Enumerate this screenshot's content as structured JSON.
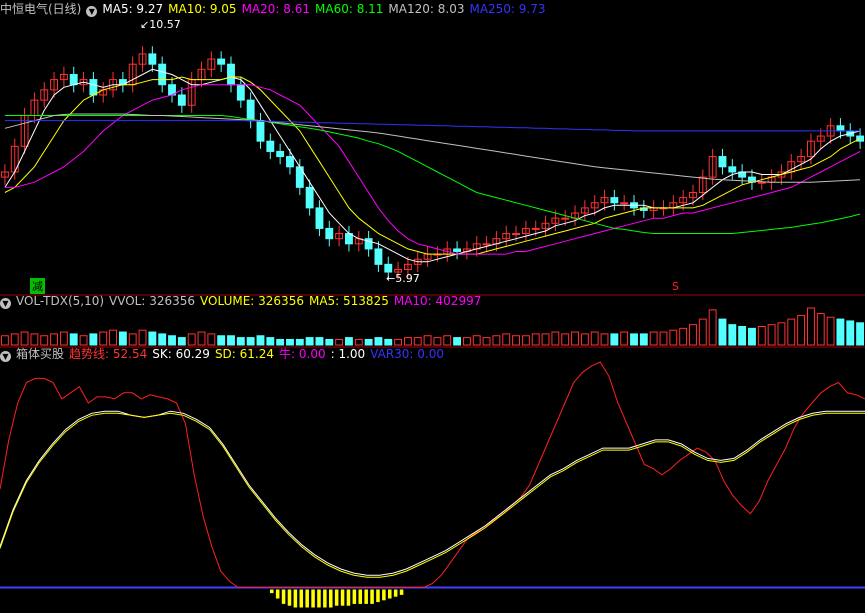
{
  "main_panel": {
    "stock_name": "中恒电气(日线)",
    "indicators": [
      {
        "label": "MA5: 9.27",
        "color": "#ffffff"
      },
      {
        "label": "MA10: 9.05",
        "color": "#ffff00"
      },
      {
        "label": "MA20: 8.61",
        "color": "#ff00ff"
      },
      {
        "label": "MA60: 8.11",
        "color": "#00ff00"
      },
      {
        "label": "MA120: 8.03",
        "color": "#c0c0c0"
      },
      {
        "label": "MA250: 9.73",
        "color": "#3333ff"
      }
    ],
    "high_label": "10.57",
    "low_label": "5.97",
    "reduce_tag": "减",
    "s_tag": "S"
  },
  "vol_panel": {
    "indicators": [
      {
        "label": "VOL-TDX(5,10)",
        "color": "#c0c0c0"
      },
      {
        "label": "VVOL: 326356",
        "color": "#c0c0c0"
      },
      {
        "label": "VOLUME: 326356",
        "color": "#ffff00"
      },
      {
        "label": "MA5: 513825",
        "color": "#ffff00"
      },
      {
        "label": "MA10: 402997",
        "color": "#ff00ff"
      }
    ]
  },
  "box_panel": {
    "indicators": [
      {
        "label": "箱体买股",
        "color": "#c0c0c0"
      },
      {
        "label": "趋势线: 52.54",
        "color": "#ff3333"
      },
      {
        "label": "SK: 60.29",
        "color": "#ffffff"
      },
      {
        "label": "SD: 61.24",
        "color": "#ffff00"
      },
      {
        "label": "牛: 0.00",
        "color": "#ff00ff"
      },
      {
        "label": ": 1.00",
        "color": "#ffffff"
      },
      {
        "label": "VAR30: 0.00",
        "color": "#3333ff"
      }
    ]
  },
  "chart_data": [
    {
      "type": "candlestick",
      "panel": "price",
      "ylim": [
        5.6,
        10.9
      ],
      "close": [
        7.9,
        8.4,
        9.0,
        9.3,
        9.5,
        9.7,
        9.8,
        9.6,
        9.7,
        9.4,
        9.5,
        9.7,
        9.6,
        10.0,
        10.2,
        10.0,
        9.6,
        9.4,
        9.2,
        9.7,
        9.9,
        10.1,
        10.0,
        9.6,
        9.3,
        8.9,
        8.5,
        8.3,
        8.2,
        8.0,
        7.6,
        7.2,
        6.8,
        6.6,
        6.7,
        6.5,
        6.6,
        6.4,
        6.1,
        5.95,
        6.0,
        6.1,
        6.2,
        6.3,
        6.3,
        6.4,
        6.35,
        6.4,
        6.5,
        6.5,
        6.6,
        6.7,
        6.7,
        6.8,
        6.8,
        6.9,
        7.0,
        7.0,
        7.1,
        7.2,
        7.3,
        7.4,
        7.3,
        7.3,
        7.2,
        7.15,
        7.2,
        7.2,
        7.3,
        7.4,
        7.5,
        7.8,
        8.2,
        8.0,
        7.9,
        7.8,
        7.7,
        7.7,
        7.8,
        7.9,
        8.1,
        8.2,
        8.5,
        8.6,
        8.8,
        8.7,
        8.6,
        8.5
      ],
      "ma": {
        "MA5": [
          7.6,
          7.9,
          8.3,
          8.7,
          9.1,
          9.4,
          9.55,
          9.6,
          9.65,
          9.6,
          9.55,
          9.6,
          9.6,
          9.7,
          9.8,
          9.9,
          9.85,
          9.8,
          9.7,
          9.6,
          9.6,
          9.65,
          9.7,
          9.75,
          9.7,
          9.5,
          9.2,
          8.9,
          8.6,
          8.3,
          8.0,
          7.7,
          7.4,
          7.1,
          6.9,
          6.7,
          6.6,
          6.55,
          6.5,
          6.4,
          6.3,
          6.2,
          6.15,
          6.15,
          6.2,
          6.25,
          6.3,
          6.35,
          6.4,
          6.45,
          6.5,
          6.55,
          6.6,
          6.65,
          6.7,
          6.75,
          6.85,
          6.9,
          6.95,
          7.05,
          7.1,
          7.2,
          7.25,
          7.25,
          7.25,
          7.25,
          7.2,
          7.2,
          7.2,
          7.25,
          7.3,
          7.45,
          7.6,
          7.75,
          7.85,
          7.9,
          7.9,
          7.85,
          7.85,
          7.85,
          7.95,
          8.05,
          8.15,
          8.35,
          8.5,
          8.6,
          8.65,
          8.7
        ],
        "MA10": [
          7.5,
          7.6,
          7.8,
          8.0,
          8.3,
          8.6,
          8.9,
          9.1,
          9.3,
          9.4,
          9.5,
          9.55,
          9.6,
          9.6,
          9.65,
          9.7,
          9.7,
          9.7,
          9.75,
          9.7,
          9.7,
          9.7,
          9.7,
          9.75,
          9.75,
          9.65,
          9.5,
          9.3,
          9.1,
          8.9,
          8.7,
          8.4,
          8.1,
          7.8,
          7.5,
          7.2,
          7.0,
          6.85,
          6.7,
          6.6,
          6.5,
          6.4,
          6.35,
          6.3,
          6.3,
          6.3,
          6.3,
          6.3,
          6.3,
          6.35,
          6.4,
          6.45,
          6.5,
          6.55,
          6.6,
          6.65,
          6.7,
          6.75,
          6.8,
          6.85,
          6.9,
          7.0,
          7.05,
          7.1,
          7.15,
          7.2,
          7.2,
          7.2,
          7.2,
          7.2,
          7.2,
          7.25,
          7.35,
          7.45,
          7.55,
          7.65,
          7.7,
          7.75,
          7.8,
          7.85,
          7.9,
          7.95,
          8.0,
          8.1,
          8.2,
          8.35,
          8.45,
          8.55
        ],
        "MA20": [
          7.6,
          7.6,
          7.65,
          7.7,
          7.8,
          7.9,
          8.0,
          8.15,
          8.3,
          8.5,
          8.7,
          8.85,
          9.0,
          9.1,
          9.2,
          9.3,
          9.35,
          9.4,
          9.5,
          9.55,
          9.6,
          9.6,
          9.6,
          9.6,
          9.6,
          9.6,
          9.55,
          9.5,
          9.4,
          9.3,
          9.2,
          9.0,
          8.8,
          8.6,
          8.4,
          8.1,
          7.8,
          7.5,
          7.2,
          6.95,
          6.75,
          6.6,
          6.5,
          6.45,
          6.4,
          6.35,
          6.3,
          6.3,
          6.3,
          6.3,
          6.3,
          6.3,
          6.35,
          6.35,
          6.4,
          6.45,
          6.5,
          6.55,
          6.6,
          6.65,
          6.7,
          6.75,
          6.8,
          6.85,
          6.9,
          6.95,
          7.0,
          7.0,
          7.05,
          7.1,
          7.1,
          7.15,
          7.2,
          7.25,
          7.3,
          7.35,
          7.4,
          7.45,
          7.5,
          7.55,
          7.6,
          7.7,
          7.8,
          7.9,
          8.0,
          8.1,
          8.2,
          8.3
        ],
        "MA60": [
          9.0,
          9.0,
          9.0,
          9.0,
          9.0,
          9.0,
          9.0,
          9.0,
          9.0,
          9.0,
          9.0,
          9.0,
          9.0,
          9.0,
          9.0,
          9.0,
          9.0,
          9.0,
          9.0,
          9.0,
          9.0,
          9.0,
          9.0,
          8.98,
          8.95,
          8.92,
          8.9,
          8.87,
          8.84,
          8.81,
          8.78,
          8.75,
          8.72,
          8.68,
          8.64,
          8.6,
          8.56,
          8.5,
          8.45,
          8.38,
          8.3,
          8.2,
          8.1,
          8.0,
          7.9,
          7.8,
          7.7,
          7.6,
          7.5,
          7.45,
          7.4,
          7.35,
          7.3,
          7.25,
          7.2,
          7.15,
          7.1,
          7.05,
          7.0,
          6.95,
          6.9,
          6.85,
          6.8,
          6.78,
          6.75,
          6.72,
          6.7,
          6.7,
          6.7,
          6.7,
          6.7,
          6.7,
          6.7,
          6.7,
          6.7,
          6.72,
          6.74,
          6.76,
          6.78,
          6.8,
          6.82,
          6.85,
          6.88,
          6.91,
          6.95,
          6.99,
          7.03,
          7.08
        ],
        "MA120": [
          8.75,
          8.8,
          8.85,
          8.9,
          8.95,
          9.0,
          9.02,
          9.03,
          9.03,
          9.03,
          9.03,
          9.03,
          9.03,
          9.02,
          9.01,
          9.0,
          9.0,
          8.99,
          8.98,
          8.97,
          8.96,
          8.95,
          8.94,
          8.93,
          8.92,
          8.91,
          8.9,
          8.88,
          8.86,
          8.84,
          8.82,
          8.8,
          8.78,
          8.76,
          8.74,
          8.72,
          8.7,
          8.68,
          8.66,
          8.63,
          8.6,
          8.57,
          8.54,
          8.51,
          8.48,
          8.45,
          8.42,
          8.39,
          8.36,
          8.33,
          8.3,
          8.27,
          8.24,
          8.21,
          8.18,
          8.15,
          8.12,
          8.09,
          8.06,
          8.03,
          8.0,
          7.98,
          7.96,
          7.94,
          7.92,
          7.9,
          7.88,
          7.86,
          7.84,
          7.82,
          7.8,
          7.78,
          7.76,
          7.75,
          7.74,
          7.73,
          7.72,
          7.71,
          7.7,
          7.7,
          7.7,
          7.7,
          7.7,
          7.71,
          7.72,
          7.73,
          7.74,
          7.75
        ],
        "MA250": [
          8.9,
          8.9,
          8.9,
          8.9,
          8.9,
          8.9,
          8.9,
          8.9,
          8.9,
          8.9,
          8.9,
          8.9,
          8.9,
          8.9,
          8.9,
          8.9,
          8.9,
          8.9,
          8.9,
          8.9,
          8.9,
          8.9,
          8.9,
          8.9,
          8.9,
          8.9,
          8.89,
          8.89,
          8.88,
          8.88,
          8.87,
          8.87,
          8.86,
          8.86,
          8.85,
          8.85,
          8.84,
          8.84,
          8.83,
          8.83,
          8.82,
          8.82,
          8.81,
          8.81,
          8.8,
          8.8,
          8.79,
          8.79,
          8.78,
          8.78,
          8.77,
          8.77,
          8.76,
          8.76,
          8.75,
          8.75,
          8.74,
          8.74,
          8.73,
          8.73,
          8.72,
          8.72,
          8.71,
          8.71,
          8.7,
          8.7,
          8.7,
          8.7,
          8.7,
          8.7,
          8.7,
          8.7,
          8.7,
          8.7,
          8.7,
          8.7,
          8.7,
          8.7,
          8.7,
          8.7,
          8.7,
          8.7,
          8.7,
          8.7,
          8.7,
          8.7,
          8.7,
          8.7
        ]
      }
    },
    {
      "type": "bar",
      "panel": "volume",
      "ylim": [
        0,
        1
      ],
      "values": [
        0.25,
        0.3,
        0.35,
        0.3,
        0.25,
        0.3,
        0.35,
        0.3,
        0.25,
        0.3,
        0.35,
        0.4,
        0.35,
        0.3,
        0.4,
        0.35,
        0.3,
        0.25,
        0.2,
        0.3,
        0.35,
        0.3,
        0.25,
        0.25,
        0.2,
        0.2,
        0.25,
        0.2,
        0.15,
        0.15,
        0.15,
        0.2,
        0.2,
        0.15,
        0.15,
        0.2,
        0.15,
        0.15,
        0.2,
        0.15,
        0.15,
        0.2,
        0.2,
        0.25,
        0.2,
        0.25,
        0.2,
        0.2,
        0.25,
        0.2,
        0.25,
        0.3,
        0.25,
        0.25,
        0.3,
        0.3,
        0.35,
        0.3,
        0.35,
        0.3,
        0.35,
        0.3,
        0.3,
        0.35,
        0.3,
        0.3,
        0.35,
        0.35,
        0.4,
        0.45,
        0.55,
        0.7,
        0.95,
        0.7,
        0.55,
        0.5,
        0.45,
        0.5,
        0.55,
        0.6,
        0.7,
        0.8,
        1.0,
        0.85,
        0.75,
        0.7,
        0.65,
        0.6
      ]
    },
    {
      "type": "line",
      "panel": "box",
      "ylim": [
        -10,
        110
      ],
      "series": [
        {
          "name": "趋势线",
          "color": "#ff2020",
          "values": [
            48,
            72,
            90,
            100,
            102,
            102,
            100,
            92,
            95,
            98,
            90,
            93,
            93,
            92,
            95,
            95,
            92,
            94,
            93,
            92,
            90,
            80,
            55,
            35,
            20,
            8,
            3,
            0,
            0,
            0,
            0,
            0,
            0,
            0,
            0,
            0,
            0,
            0,
            0,
            0,
            0,
            0,
            0,
            0,
            0,
            0,
            0,
            0,
            0,
            2,
            6,
            12,
            18,
            24,
            27,
            30,
            33,
            36,
            40,
            44,
            50,
            60,
            70,
            80,
            90,
            100,
            105,
            108,
            110,
            103,
            90,
            80,
            70,
            60,
            58,
            55,
            58,
            62,
            65,
            68,
            66,
            62,
            52,
            45,
            40,
            36,
            42,
            52,
            60,
            68,
            78,
            85,
            90,
            95,
            98,
            100,
            95,
            94,
            92
          ]
        },
        {
          "name": "SK",
          "color": "#ffffff",
          "values": [
            20,
            38,
            52,
            62,
            70,
            77,
            82,
            85,
            86,
            86,
            84,
            83,
            84,
            86,
            85,
            82,
            78,
            70,
            60,
            50,
            42,
            34,
            27,
            21,
            16,
            12,
            9,
            7,
            6,
            6,
            7,
            9,
            12,
            15,
            18,
            22,
            26,
            30,
            35,
            40,
            45,
            50,
            55,
            58,
            62,
            65,
            68,
            68,
            68,
            70,
            72,
            72,
            70,
            66,
            63,
            62,
            63,
            67,
            72,
            76,
            80,
            83,
            85,
            86,
            86,
            86,
            86
          ]
        },
        {
          "name": "SD",
          "color": "#ffff00",
          "values": [
            19,
            37,
            51,
            61,
            69,
            76,
            81,
            84,
            85,
            85,
            84,
            83,
            84,
            85,
            84,
            81,
            77,
            69,
            59,
            49,
            41,
            33,
            26,
            20,
            15,
            11,
            8,
            6,
            5,
            5,
            6,
            8,
            11,
            14,
            17,
            21,
            25,
            29,
            34,
            39,
            44,
            49,
            54,
            57,
            61,
            64,
            67,
            67,
            67,
            69,
            71,
            71,
            69,
            65,
            62,
            61,
            62,
            66,
            71,
            75,
            79,
            82,
            84,
            85,
            85,
            85,
            85
          ]
        }
      ],
      "bars": {
        "color": "#ffff00",
        "values": [
          0.2,
          0.5,
          0.8,
          0.9,
          1,
          1,
          1,
          1,
          1,
          1,
          1,
          0.9,
          0.9,
          0.9,
          0.8,
          0.8,
          0.8,
          0.8,
          0.7,
          0.6,
          0.5,
          0.4,
          0.3
        ]
      }
    }
  ]
}
